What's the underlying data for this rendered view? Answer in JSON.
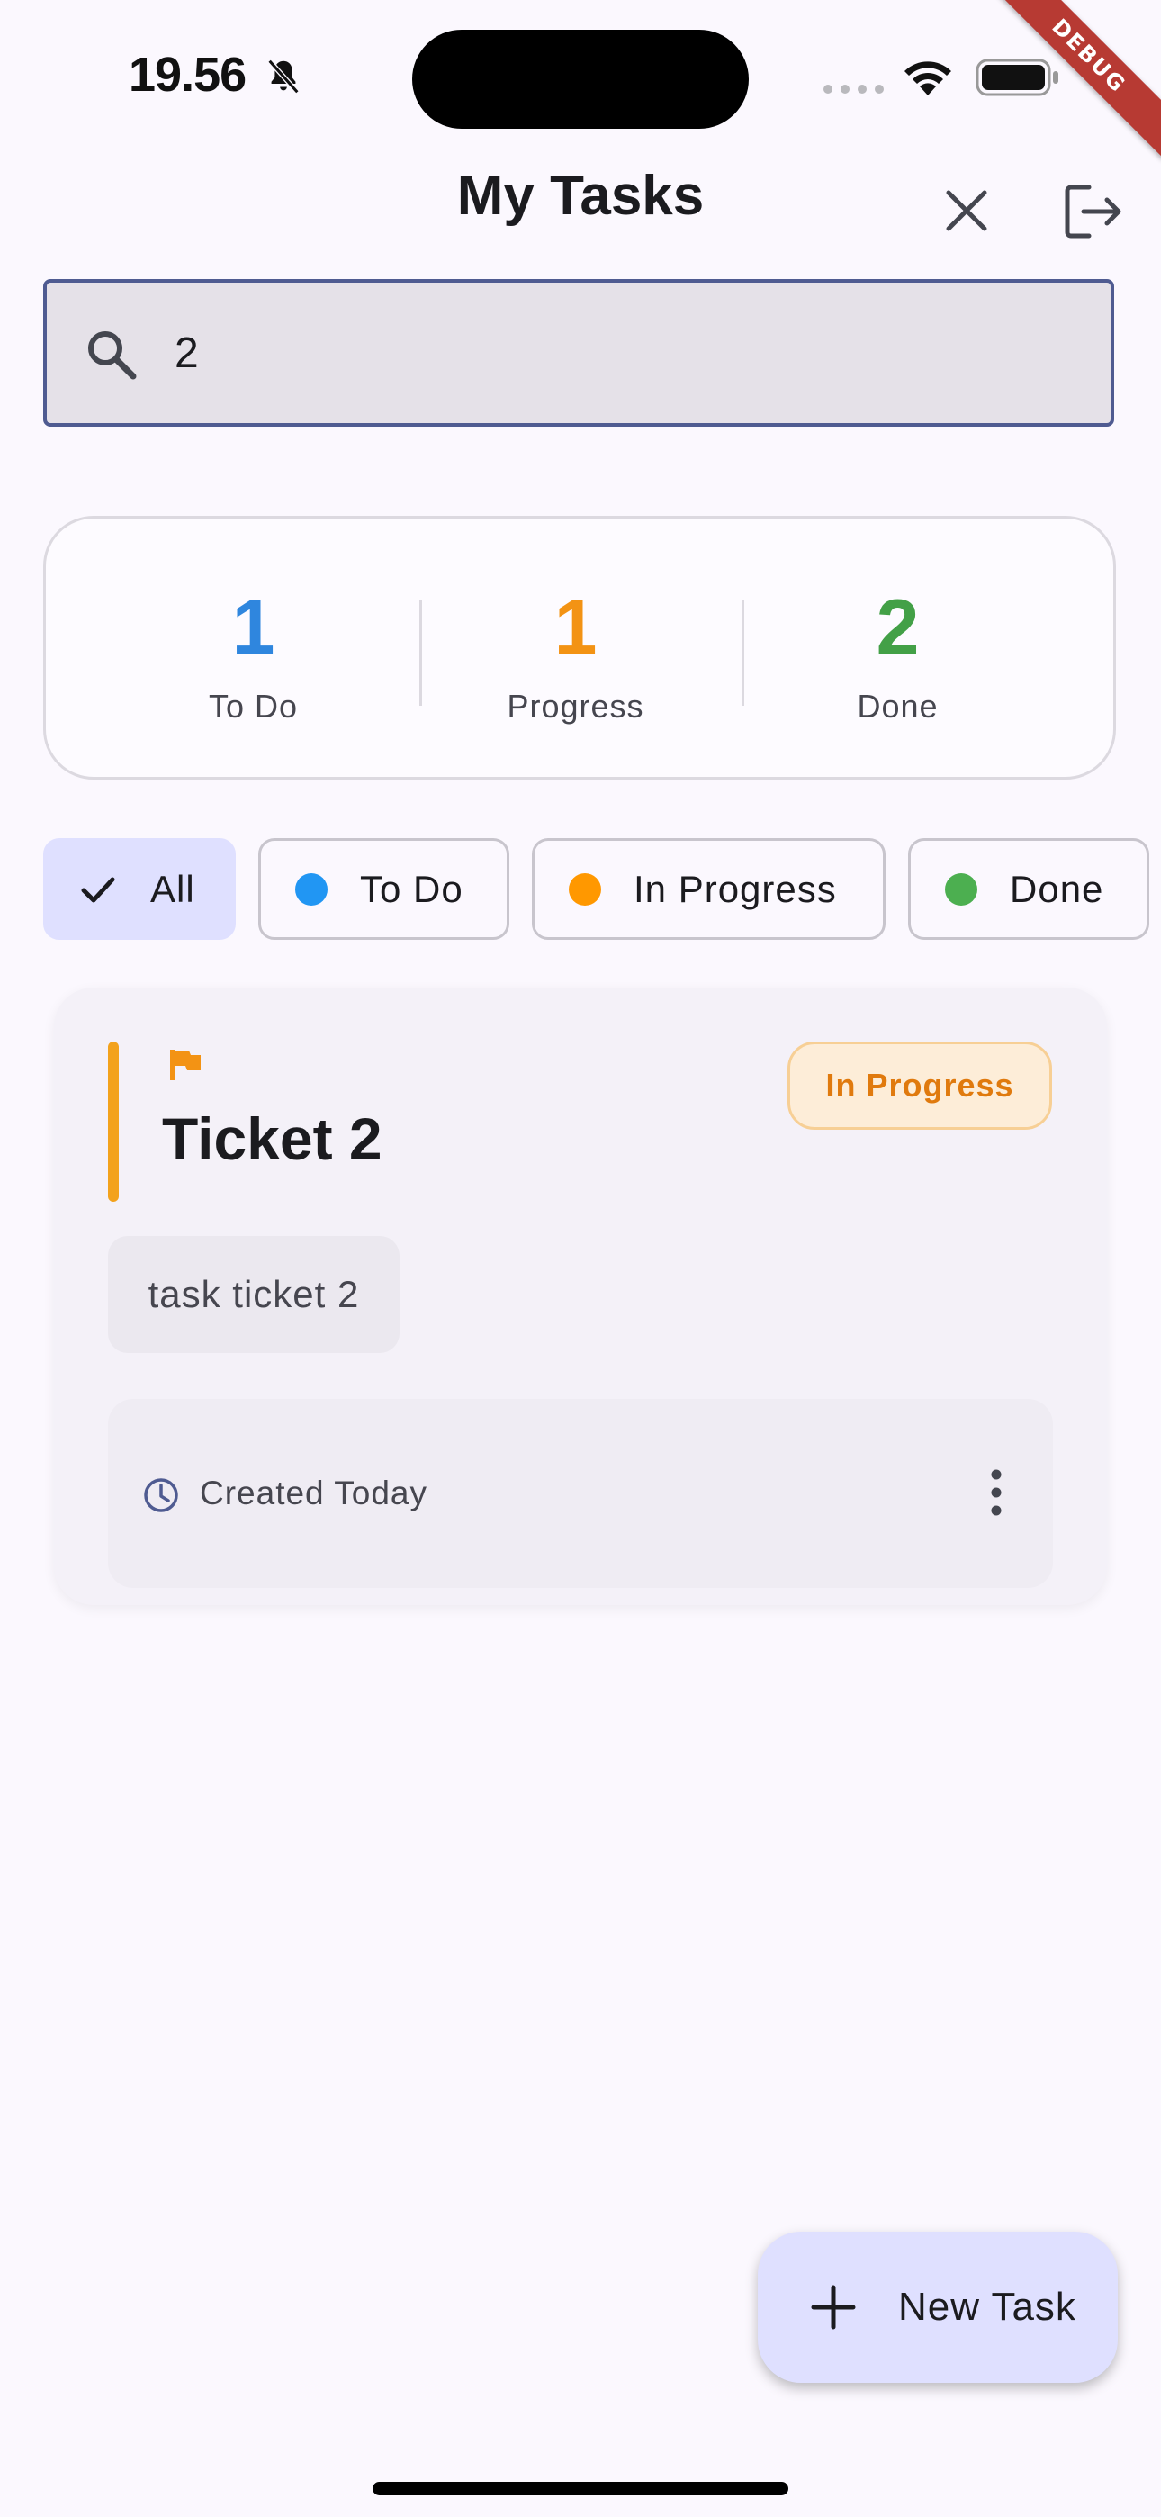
{
  "status_bar": {
    "time": "19.56"
  },
  "debug_banner": "DEBUG",
  "app_bar": {
    "title": "My Tasks"
  },
  "search": {
    "value": "2",
    "placeholder": ""
  },
  "stats": [
    {
      "value": "1",
      "label": "To Do",
      "color": "#2f86de"
    },
    {
      "value": "1",
      "label": "Progress",
      "color": "#f39314"
    },
    {
      "value": "2",
      "label": "Done",
      "color": "#43a047"
    }
  ],
  "filters": [
    {
      "label": "All",
      "selected": true
    },
    {
      "label": "To Do",
      "dot_color": "#2196f3"
    },
    {
      "label": "In Progress",
      "dot_color": "#ff9800"
    },
    {
      "label": "Done",
      "dot_color": "#4caf50"
    }
  ],
  "task": {
    "title": "Ticket 2",
    "status": "In Progress",
    "description": "task ticket 2",
    "created": "Created Today",
    "priority_color": "#f3a21c"
  },
  "fab": {
    "label": "New Task"
  }
}
